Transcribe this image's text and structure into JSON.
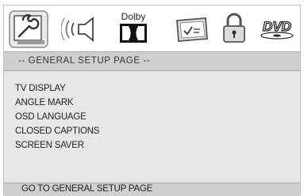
{
  "icons": [
    {
      "name": "general-setup-icon",
      "selected": true
    },
    {
      "name": "speaker-audio-icon"
    },
    {
      "name": "dolby-icon",
      "label": "Dolby"
    },
    {
      "name": "video-setup-icon"
    },
    {
      "name": "lock-icon"
    },
    {
      "name": "dvd-icon",
      "label": "DVD"
    }
  ],
  "header": {
    "title": "-- GENERAL SETUP PAGE --"
  },
  "menu": {
    "items": [
      {
        "label": "TV DISPLAY"
      },
      {
        "label": "ANGLE MARK"
      },
      {
        "label": "OSD LANGUAGE"
      },
      {
        "label": "CLOSED CAPTIONS"
      },
      {
        "label": "SCREEN SAVER"
      }
    ]
  },
  "status": {
    "text": "GO TO GENERAL SETUP PAGE"
  },
  "colors": {
    "background": "#e7e7e7",
    "header_band": "#cfcfcf",
    "text": "#222222"
  }
}
